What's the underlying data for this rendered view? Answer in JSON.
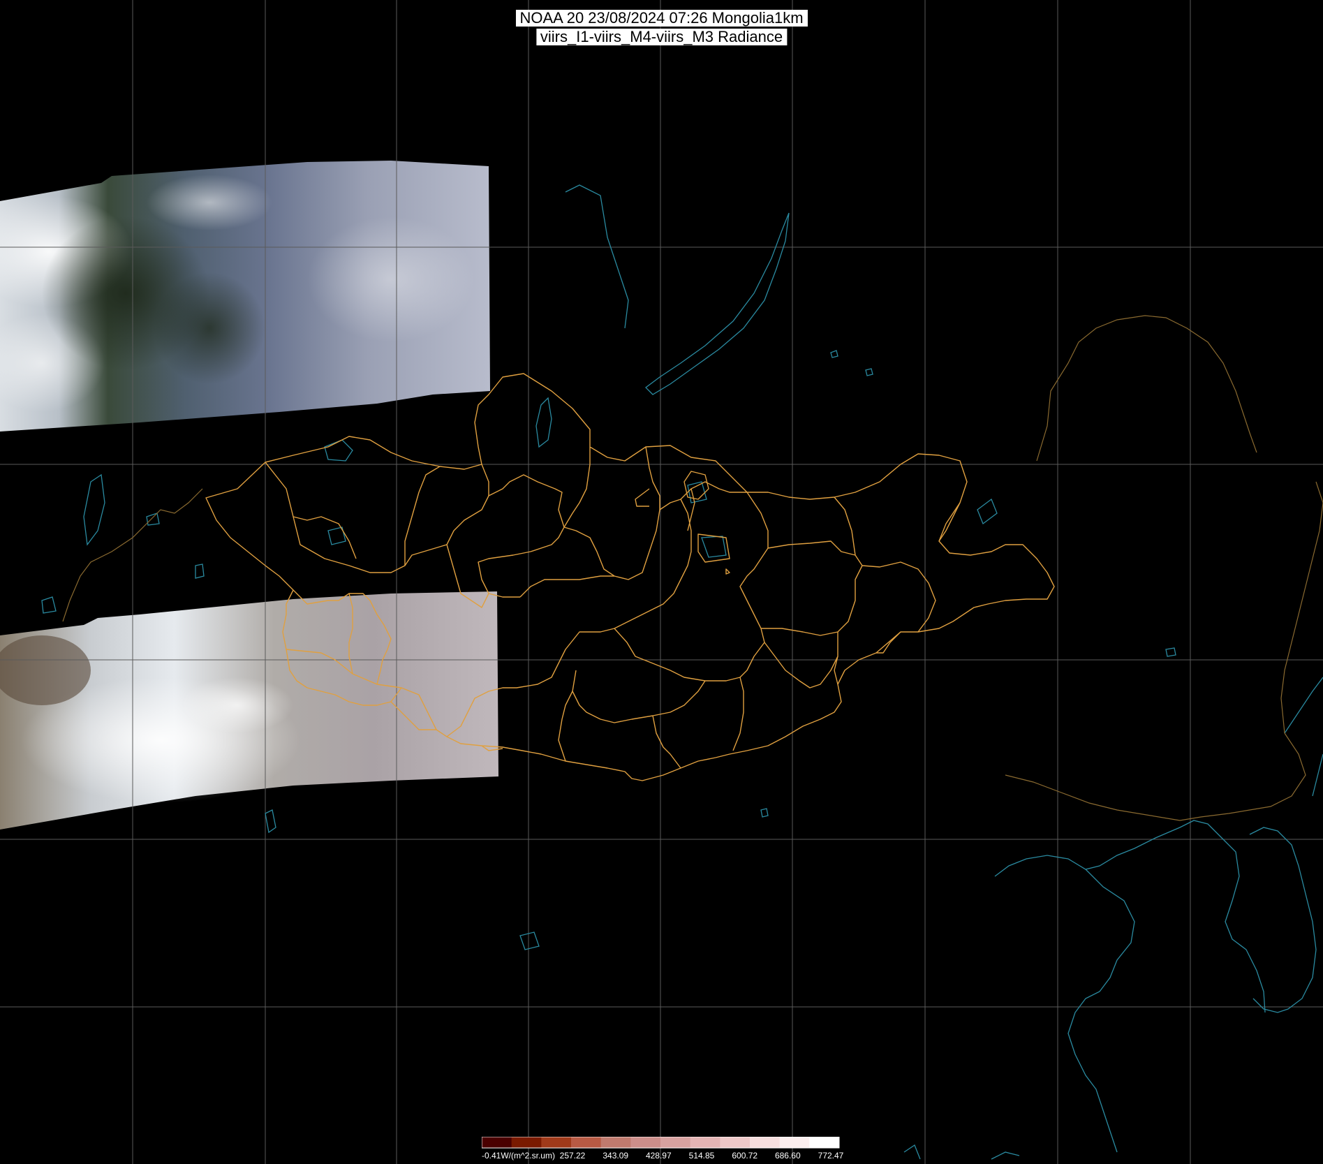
{
  "title": {
    "line1": "NOAA 20 23/08/2024 07:26 Mongolia1km",
    "line2": "viirs_I1-viirs_M4-viirs_M3 Radiance"
  },
  "colors": {
    "background": "#000000",
    "grid": "#5a5a5a",
    "borders": "#e0a040",
    "coastline": "#2a8aa0",
    "country_line": "#8a6a30"
  },
  "layers": [
    "satellite-swath-north",
    "satellite-swath-south",
    "lat-lon-grid",
    "coastlines-lakes",
    "province-borders",
    "country-borders"
  ],
  "colorbar": {
    "start_label": "-0.41W/(m^2.sr.um)",
    "tick_labels": [
      "257.22",
      "343.09",
      "428.97",
      "514.85",
      "600.72",
      "686.60",
      "772.47"
    ],
    "colors": [
      "#4a0000",
      "#7a1a00",
      "#a03a1a",
      "#b85a44",
      "#c07a6e",
      "#cc8e8a",
      "#d8a2a0",
      "#e4b4b4",
      "#eec8c8",
      "#f6dede",
      "#fbeeee",
      "#ffffff"
    ]
  }
}
